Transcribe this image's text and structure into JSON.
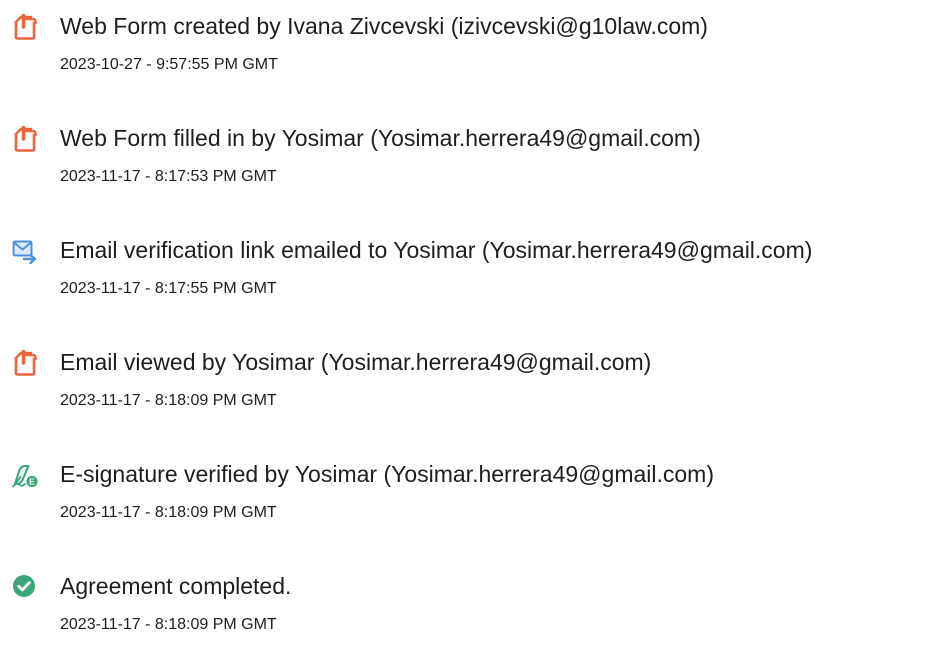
{
  "events": [
    {
      "title": "Web Form created by Ivana Zivcevski (izivcevski@g10law.com)",
      "timestamp": "2023-10-27 - 9:57:55 PM GMT",
      "icon": "document-icon",
      "color": "#e8673d"
    },
    {
      "title": "Web Form filled in by Yosimar (Yosimar.herrera49@gmail.com)",
      "timestamp": "2023-11-17 - 8:17:53 PM GMT",
      "icon": "document-icon",
      "color": "#e8673d"
    },
    {
      "title": "Email verification link emailed to Yosimar (Yosimar.herrera49@gmail.com)",
      "timestamp": "2023-11-17 - 8:17:55 PM GMT",
      "icon": "email-send-icon",
      "color": "#4d8fe0"
    },
    {
      "title": "Email viewed by Yosimar (Yosimar.herrera49@gmail.com)",
      "timestamp": "2023-11-17 - 8:18:09 PM GMT",
      "icon": "document-icon",
      "color": "#e8673d"
    },
    {
      "title": "E-signature verified by Yosimar (Yosimar.herrera49@gmail.com)",
      "timestamp": "2023-11-17 - 8:18:09 PM GMT",
      "icon": "e-signature-icon",
      "color": "#3aa676"
    },
    {
      "title": "Agreement completed.",
      "timestamp": "2023-11-17 - 8:18:09 PM GMT",
      "icon": "check-circle-icon",
      "color": "#3aa676"
    }
  ]
}
